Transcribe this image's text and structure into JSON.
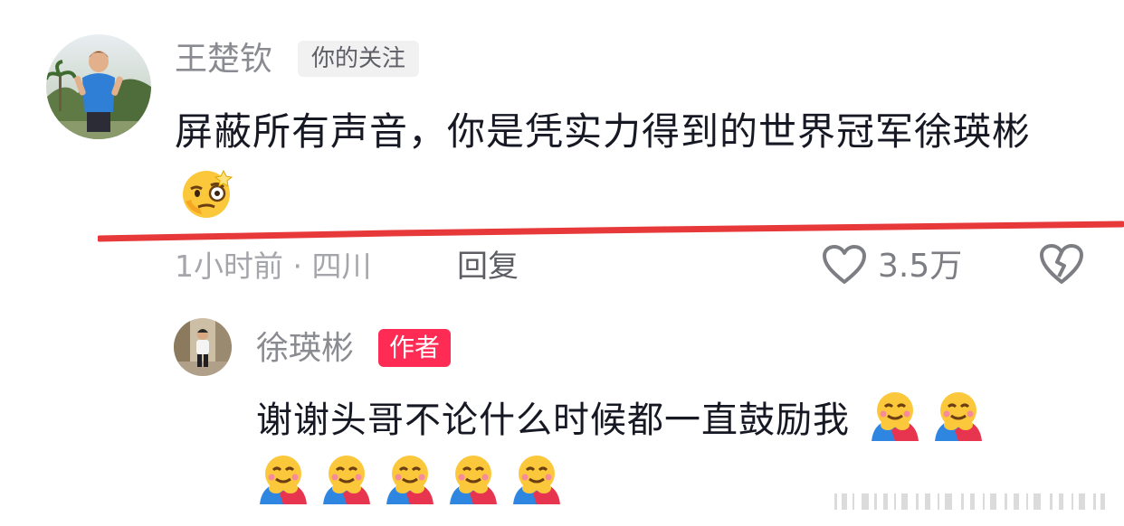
{
  "comment": {
    "username": "王楚钦",
    "follow_badge": "你的关注",
    "text": "屏蔽所有声音，你是凭实力得到的世界冠军徐瑛彬",
    "emoji": "smirk-monocle-emoji",
    "meta": "1小时前 · 四川",
    "reply_label": "回复",
    "like_count": "3.5万",
    "icons": {
      "like": "heart-outline-icon",
      "dislike": "broken-heart-icon"
    },
    "highlight_color": "#e8393a"
  },
  "reply": {
    "username": "徐瑛彬",
    "author_badge": "作者",
    "text": "谢谢头哥不论什么时候都一直鼓励我",
    "emoji": "hugging-face-emoji",
    "emoji_count": 7,
    "badge_color": "#fe2c55"
  }
}
